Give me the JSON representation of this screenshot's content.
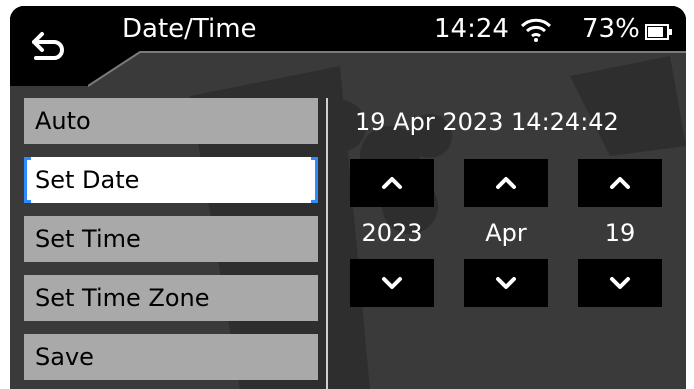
{
  "header": {
    "title": "Date/Time",
    "back_icon": "back-arrow-icon"
  },
  "status": {
    "time": "14:24",
    "wifi_icon": "wifi-icon",
    "battery_percent": "73%",
    "battery_icon": "battery-icon"
  },
  "menu": {
    "items": [
      {
        "label": "Auto"
      },
      {
        "label": "Set Date"
      },
      {
        "label": "Set Time"
      },
      {
        "label": "Set Time Zone"
      },
      {
        "label": "Save"
      }
    ],
    "selected": "Set Date"
  },
  "date_panel": {
    "current_datetime": "19 Apr 2023 14:24:42",
    "year": "2023",
    "month": "Apr",
    "day": "19",
    "up_icon": "chevron-up-icon",
    "down_icon": "chevron-down-icon"
  },
  "colors": {
    "background": "#3a3a3a",
    "menu_item": "#a9a9a9",
    "selected_item": "#ffffff",
    "selection_bracket": "#2f8cff",
    "control": "#000000",
    "text_light": "#ffffff"
  }
}
